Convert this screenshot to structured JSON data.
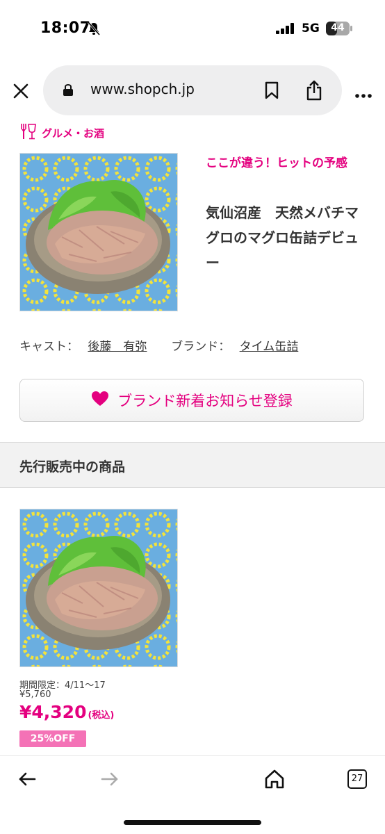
{
  "status_bar": {
    "time": "18:07",
    "network": "5G",
    "battery": "44",
    "icons": [
      "bell-slash-icon",
      "signal-icon",
      "battery-icon"
    ]
  },
  "browser": {
    "url": "www.shopch.jp",
    "icons": [
      "close-icon",
      "lock-icon",
      "bookmark-icon",
      "share-icon",
      "more-icon"
    ]
  },
  "category": {
    "label": "グルメ・お酒",
    "icon": "cutlery-glass-icon"
  },
  "product": {
    "tagline": "ここが違う！ヒットの予感",
    "title": "気仙沼産　天然メバチマグロのマグロ缶詰デビュー",
    "cast_label": "キャスト：",
    "cast_name": "後藤　有弥",
    "brand_label": "ブランド：",
    "brand_name": "タイム缶詰"
  },
  "brand_follow": {
    "label": "ブランド新着お知らせ登録",
    "icon": "heart-icon"
  },
  "section": {
    "title": "先行販売中の商品"
  },
  "item": {
    "period": "期間限定：4/11〜17",
    "original_price": "¥5,760",
    "sale_price": "¥4,320",
    "tax_note": "(税込)",
    "discount": "25%OFF"
  },
  "bottom_nav": {
    "tab_count": "27",
    "icons": [
      "back-arrow-icon",
      "forward-arrow-icon",
      "home-icon",
      "tabs-icon"
    ]
  },
  "colors": {
    "accent": "#e4007f",
    "badge": "#f472b6",
    "url_bar": "#eeeeef"
  }
}
